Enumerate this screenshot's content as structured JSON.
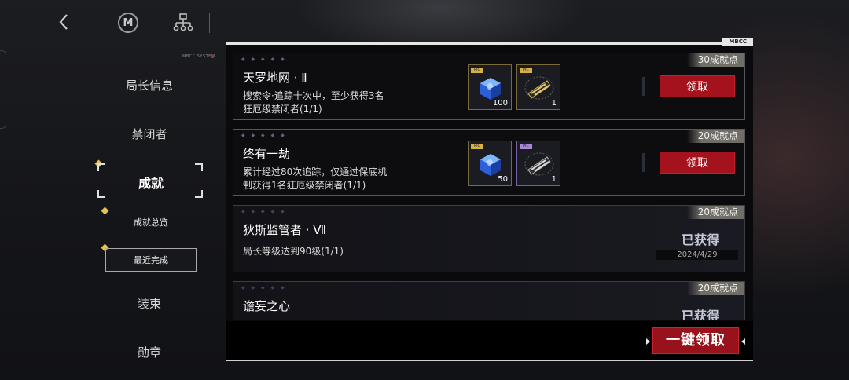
{
  "topbar": {
    "logo_text": "M"
  },
  "system_label": "MBCC SYSTEM",
  "nav": {
    "items": [
      {
        "label": "局长信息"
      },
      {
        "label": "禁闭者"
      },
      {
        "label": "成就"
      },
      {
        "label": "装束"
      },
      {
        "label": "勋章"
      }
    ],
    "sub_items": [
      {
        "label": "成就总览"
      },
      {
        "label": "最近完成"
      }
    ]
  },
  "panel": {
    "tag": "MBCC"
  },
  "achievements": [
    {
      "title": "天罗地网 · Ⅱ",
      "desc_line1": "搜索令·追踪十次中，至少获得3名",
      "desc_line2": "狂厄级禁闭者(1/1)",
      "points": "30成就点",
      "reward1": {
        "tag": "PIC EN",
        "count": "100",
        "icon": "blue-crystal-icon"
      },
      "reward2": {
        "tag": "PIC EN",
        "count": "1",
        "icon": "gold-chain-icon"
      },
      "action": "领取"
    },
    {
      "title": "终有一劫",
      "desc_line1": "累计经过80次追踪，仅通过保底机",
      "desc_line2": "制获得1名狂厄级禁闭者(1/1)",
      "points": "20成就点",
      "reward1": {
        "tag": "PIC EN",
        "count": "50",
        "icon": "blue-crystal-icon"
      },
      "reward2": {
        "tag": "PIC EN",
        "count": "1",
        "icon": "purple-chain-icon"
      },
      "action": "领取"
    },
    {
      "title": "狄斯监管者 · Ⅶ",
      "desc_line1": "局长等级达到90级(1/1)",
      "points": "20成就点",
      "status": "已获得",
      "date": "2024/4/29"
    },
    {
      "title": "谵妄之心",
      "points": "20成就点",
      "status": "已获得"
    }
  ],
  "claim_all": "一键领取",
  "colors": {
    "accent_red": "#a4121e",
    "gold": "#e9c24a",
    "points_bg": "#6f6d66"
  }
}
